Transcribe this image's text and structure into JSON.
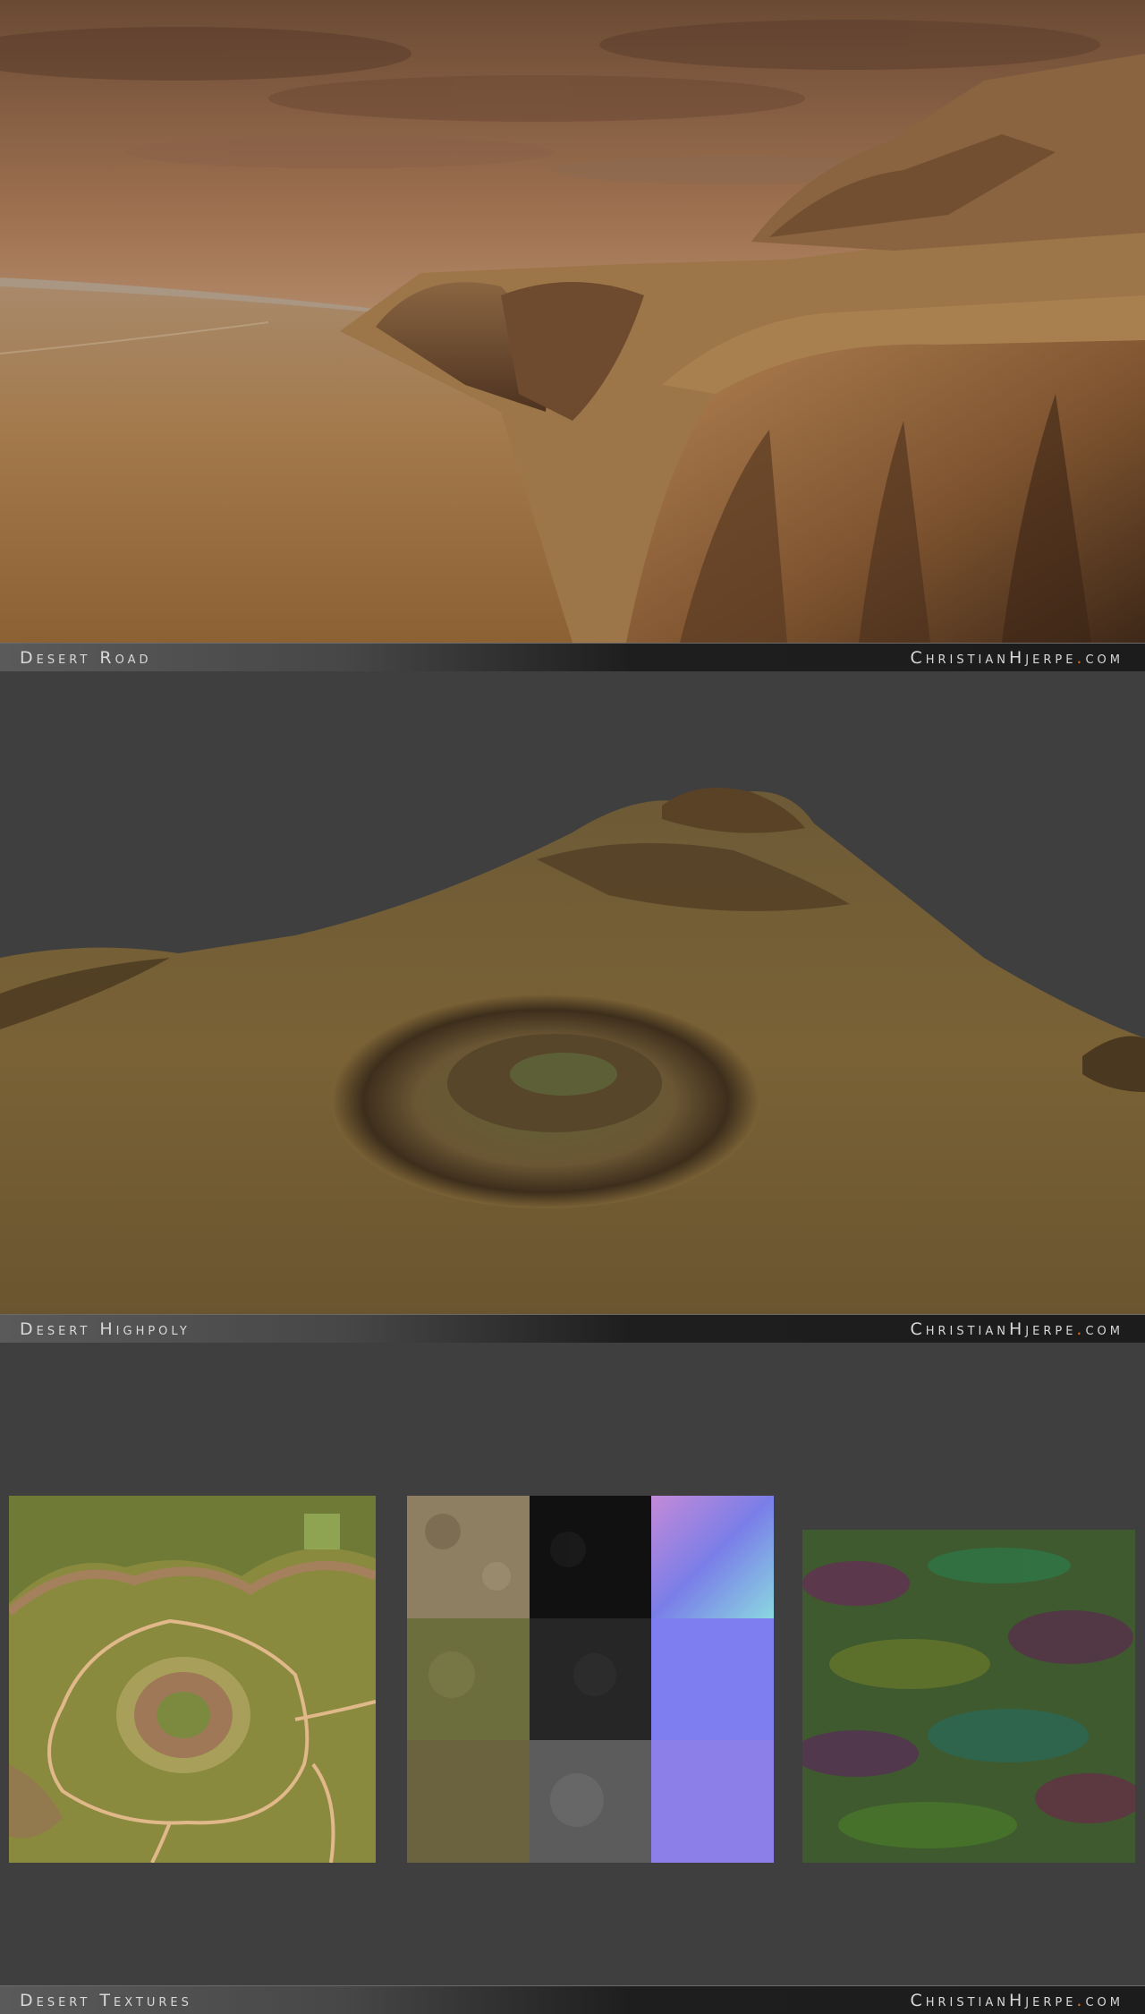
{
  "sections": [
    {
      "caption": "Desert Road",
      "site": "ChristianHjerpe",
      "site_dot": ".",
      "site_tld": "com"
    },
    {
      "caption": "Desert Highpoly",
      "site": "ChristianHjerpe",
      "site_dot": ".",
      "site_tld": "com"
    },
    {
      "caption": "Desert Textures",
      "site": "ChristianHjerpe",
      "site_dot": ".",
      "site_tld": "com"
    }
  ],
  "colors": {
    "background": "#3f3f3f",
    "caption_text": "#d8d8d8",
    "accent_dot": "#e06b1b"
  }
}
